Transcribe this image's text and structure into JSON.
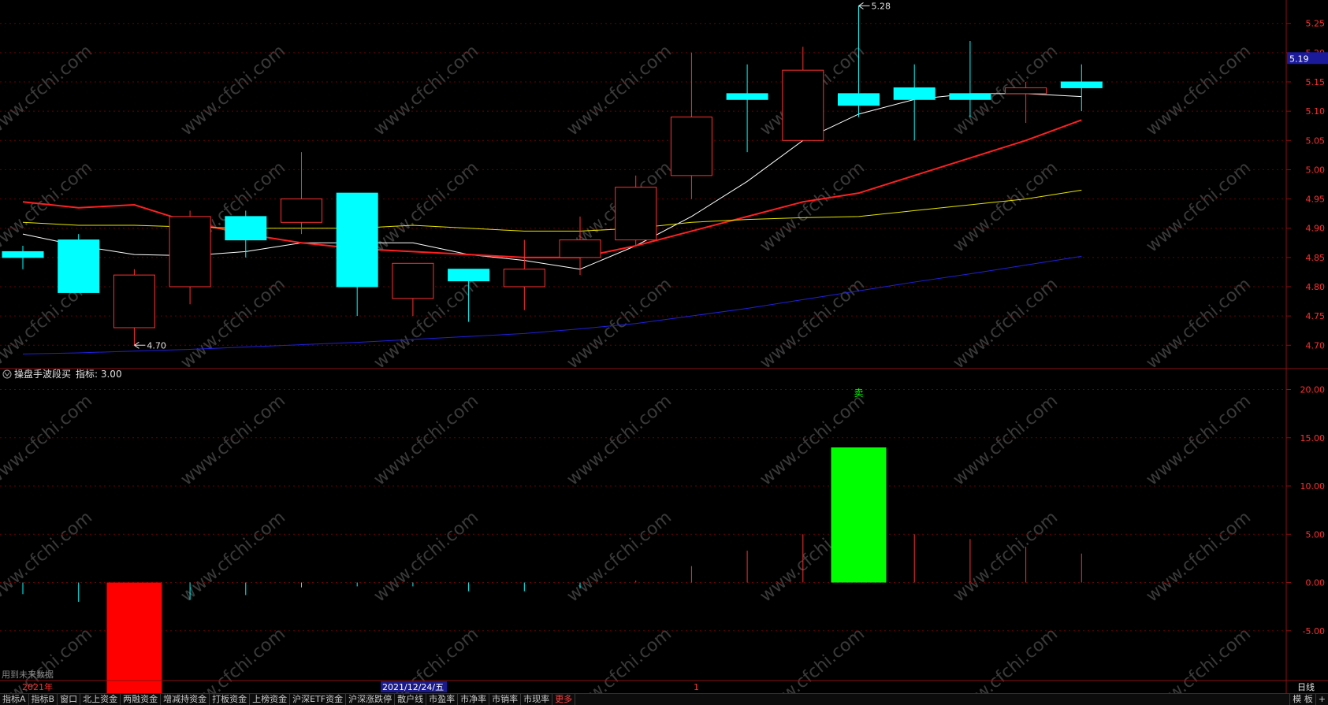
{
  "chart_data": [
    {
      "type": "candlestick",
      "name": "price",
      "ylim": [
        4.66,
        5.29
      ],
      "y_ticks": [
        "5.25",
        "5.20",
        "5.15",
        "5.10",
        "5.05",
        "5.00",
        "4.95",
        "4.90",
        "4.85",
        "4.80",
        "4.75",
        "4.70"
      ],
      "candles": [
        {
          "open": 4.86,
          "close": 4.85,
          "high": 4.87,
          "low": 4.83
        },
        {
          "open": 4.88,
          "close": 4.79,
          "high": 4.89,
          "low": 4.79
        },
        {
          "open": 4.73,
          "close": 4.82,
          "high": 4.83,
          "low": 4.7
        },
        {
          "open": 4.8,
          "close": 4.92,
          "high": 4.93,
          "low": 4.77
        },
        {
          "open": 4.92,
          "close": 4.88,
          "high": 4.93,
          "low": 4.85
        },
        {
          "open": 4.91,
          "close": 4.95,
          "high": 5.03,
          "low": 4.89
        },
        {
          "open": 4.96,
          "close": 4.8,
          "high": 4.96,
          "low": 4.75
        },
        {
          "open": 4.78,
          "close": 4.84,
          "high": 4.84,
          "low": 4.75
        },
        {
          "open": 4.83,
          "close": 4.81,
          "high": 4.83,
          "low": 4.74
        },
        {
          "open": 4.8,
          "close": 4.83,
          "high": 4.88,
          "low": 4.76
        },
        {
          "open": 4.85,
          "close": 4.88,
          "high": 4.92,
          "low": 4.82
        },
        {
          "open": 4.88,
          "close": 4.97,
          "high": 4.99,
          "low": 4.87
        },
        {
          "open": 4.99,
          "close": 5.09,
          "high": 5.2,
          "low": 4.95
        },
        {
          "open": 5.13,
          "close": 5.12,
          "high": 5.18,
          "low": 5.03
        },
        {
          "open": 5.05,
          "close": 5.17,
          "high": 5.21,
          "low": 5.05
        },
        {
          "open": 5.13,
          "close": 5.11,
          "high": 5.28,
          "low": 5.09
        },
        {
          "open": 5.14,
          "close": 5.12,
          "high": 5.18,
          "low": 5.05
        },
        {
          "open": 5.13,
          "close": 5.12,
          "high": 5.22,
          "low": 5.09
        },
        {
          "open": 5.13,
          "close": 5.14,
          "high": 5.15,
          "low": 5.08
        },
        {
          "open": 5.15,
          "close": 5.14,
          "high": 5.18,
          "low": 5.1
        }
      ],
      "moving_averages": [
        {
          "color": "#ffffff",
          "width": 1,
          "values": [
            4.89,
            4.87,
            4.855,
            4.853,
            4.86,
            4.875,
            4.875,
            4.875,
            4.855,
            4.845,
            4.83,
            4.87,
            4.92,
            4.98,
            5.05,
            5.095,
            5.12,
            5.13,
            5.13,
            5.125
          ]
        },
        {
          "color": "#ff2020",
          "width": 2,
          "values": [
            4.945,
            4.935,
            4.94,
            4.91,
            4.89,
            4.875,
            4.865,
            4.86,
            4.855,
            4.85,
            4.85,
            4.87,
            4.895,
            4.92,
            4.945,
            4.96,
            4.99,
            5.02,
            5.05,
            5.085
          ]
        },
        {
          "color": "#e6e600",
          "width": 1,
          "values": [
            4.91,
            4.905,
            4.905,
            4.902,
            4.9,
            4.9,
            4.9,
            4.905,
            4.9,
            4.895,
            4.895,
            4.9,
            4.91,
            4.915,
            4.918,
            4.92,
            4.93,
            4.94,
            4.95,
            4.965
          ]
        },
        {
          "color": "#2020e0",
          "width": 1,
          "values": [
            4.685,
            4.687,
            4.69,
            4.693,
            4.697,
            4.701,
            4.705,
            4.71,
            4.715,
            4.72,
            4.728,
            4.737,
            4.75,
            4.763,
            4.778,
            4.793,
            4.808,
            4.822,
            4.837,
            4.852
          ]
        }
      ],
      "annotations": [
        {
          "label": "5.28",
          "candle": 15,
          "value": 5.28
        },
        {
          "label": "4.70",
          "candle": 2,
          "value": 4.7
        }
      ],
      "last_price": "5.19"
    },
    {
      "type": "bar",
      "name": "indicator",
      "ylim": [
        -10.0,
        22.0
      ],
      "y_ticks": [
        "20.00",
        "15.00",
        "10.00",
        "5.00",
        "0.00",
        "-5.00"
      ],
      "values": [
        -1.2,
        -2.0,
        -14.0,
        -1.8,
        -1.3,
        -0.5,
        -0.4,
        -0.4,
        -0.9,
        -0.9,
        -0.6,
        0.2,
        1.7,
        3.3,
        5.0,
        14.0,
        5.0,
        4.5,
        3.7,
        3.0
      ],
      "signals": [
        {
          "candle": 2,
          "value": -14.0,
          "kind": "buy",
          "color": "#ff0000"
        },
        {
          "candle": 15,
          "value": 14.0,
          "kind": "sell",
          "color": "#00ff00"
        }
      ],
      "signal_label": "卖"
    }
  ],
  "indicator_panel": {
    "title": "操盘手波段买",
    "value_text": "指标: 3.00"
  },
  "bottom_left_note": "用到未来数据",
  "time_axis": {
    "year": "2021年",
    "date": "2021/12/24/五",
    "marker": "1",
    "period": "日线"
  },
  "tabs": [
    "指标A",
    "指标B",
    "窗口",
    "北上资金",
    "两融资金",
    "增减持资金",
    "打板资金",
    "上榜资金",
    "沪深ETF资金",
    "沪深涨跌停",
    "散户线",
    "市盈率",
    "市净率",
    "市销率",
    "市现率",
    "更多"
  ],
  "right_tabs": [
    "模 板",
    "+"
  ],
  "colors": {
    "up": "#ff3030",
    "down": "#00ffff",
    "axis": "#8b1010",
    "grid": "#6a0000",
    "buy": "#ff0000",
    "sell": "#00ff00"
  },
  "watermark": "www.cfchi.com"
}
